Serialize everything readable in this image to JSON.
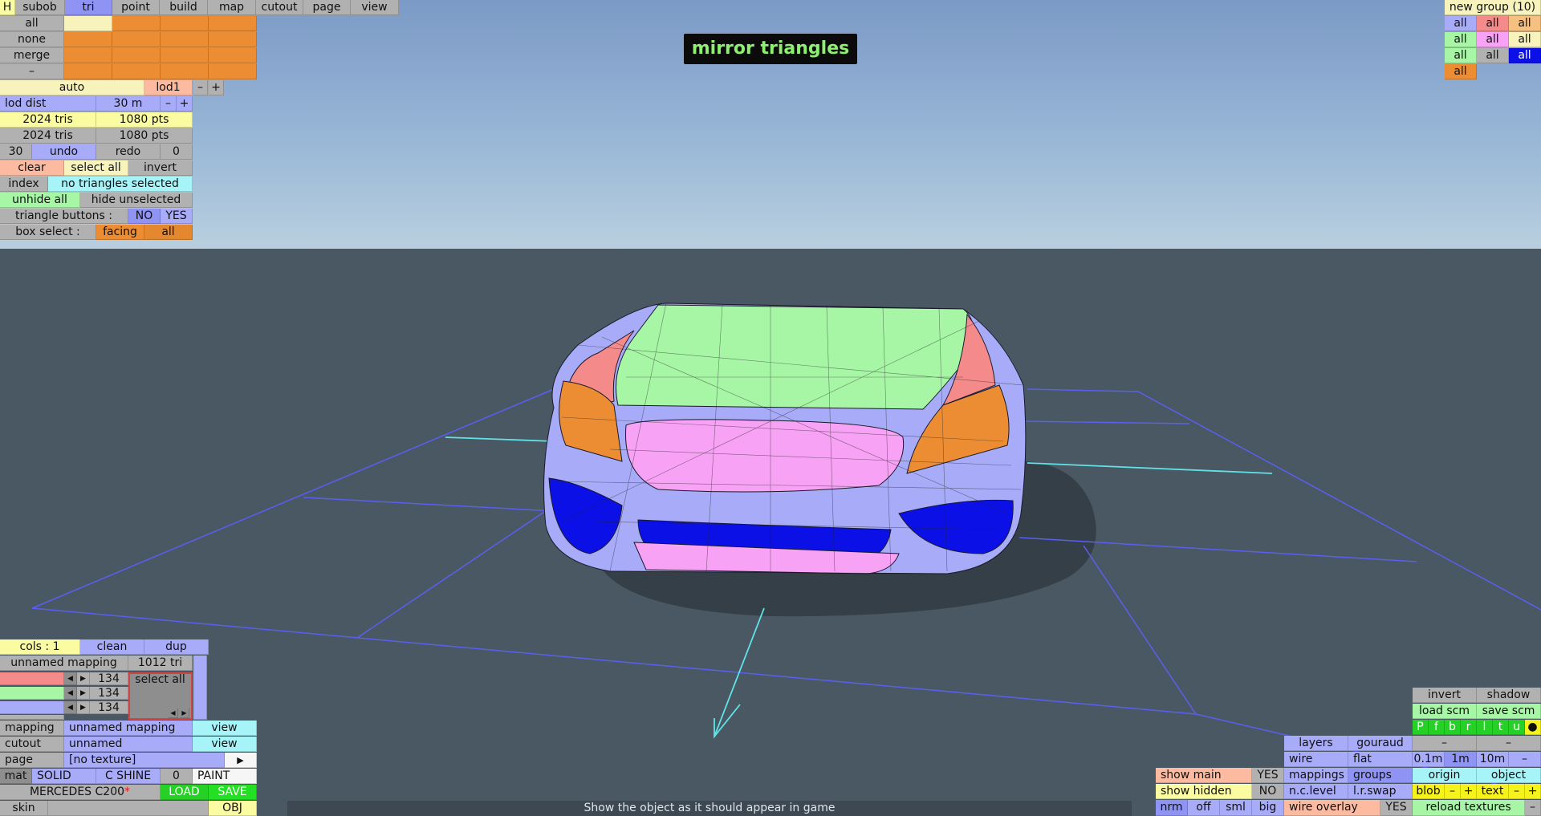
{
  "title": "mirror triangles",
  "menu": {
    "tabs": [
      "H",
      "subob",
      "tri",
      "point",
      "build",
      "map",
      "cutout",
      "page",
      "view"
    ]
  },
  "selection": {
    "rows": [
      "all",
      "none",
      "merge",
      "–"
    ]
  },
  "lod": {
    "auto": "auto",
    "name": "lod1",
    "minus": "–",
    "plus": "+",
    "dist_label": "lod dist",
    "dist_value": "30 m"
  },
  "stats": {
    "tris1": "2024 tris",
    "pts1": "1080 pts",
    "tris2": "2024 tris",
    "pts2": "1080 pts"
  },
  "history": {
    "count": "30",
    "undo": "undo",
    "redo": "redo",
    "redo_count": "0"
  },
  "edit": {
    "clear": "clear",
    "select_all": "select all",
    "invert": "invert"
  },
  "index": {
    "label": "index",
    "value": "no triangles selected"
  },
  "visibility": {
    "unhide_all": "unhide all",
    "hide_unselected": "hide unselected"
  },
  "triangle_buttons": {
    "label": "triangle buttons :",
    "no": "NO",
    "yes": "YES"
  },
  "box_select": {
    "label": "box select :",
    "facing": "facing",
    "all": "all"
  },
  "groups_panel": {
    "title": "new group (10)",
    "all": "all"
  },
  "cols": {
    "label": "cols : 1",
    "clean": "clean",
    "dup": "dup",
    "mapping_name": "unnamed mapping",
    "tri_count": "1012 tri",
    "rows": [
      {
        "count": "134",
        "color": "#f48a8a"
      },
      {
        "count": "134",
        "color": "#a6f6a6"
      },
      {
        "count": "134",
        "color": "#a8abf8"
      }
    ],
    "select_all": "select all"
  },
  "bottom_left": {
    "mapping_label": "mapping",
    "mapping_value": "unnamed mapping",
    "view": "view",
    "cutout_label": "cutout",
    "cutout_value": "unnamed",
    "page_label": "page",
    "page_value": "[no texture]",
    "arrow": "▶",
    "mat": "mat",
    "solid": "SOLID",
    "cshine": "C SHINE",
    "zero": "0",
    "paint": "PAINT",
    "file": "MERCEDES C200",
    "asterisk": "*",
    "load": "LOAD",
    "save": "SAVE",
    "skin": "skin",
    "obj": "OBJ"
  },
  "status_text": "Show the object as it should appear in game",
  "br": {
    "invert": "invert",
    "shadow": "shadow",
    "load_scm": "load scm",
    "save_scm": "save scm",
    "letters": [
      "P",
      "f",
      "b",
      "r",
      "l",
      "t",
      "u",
      "●"
    ],
    "dash": "–",
    "layers": "layers",
    "gouraud": "gouraud",
    "wire": "wire",
    "flat": "flat",
    "s01": "0.1m",
    "s1": "1m",
    "s10": "10m",
    "mappings": "mappings",
    "groups": "groups",
    "origin": "origin",
    "object": "object",
    "nclevel": "n.c.level",
    "lrswap": "l.r.swap",
    "blob": "blob",
    "plus": "+",
    "text": "text",
    "show_main": "show main",
    "yes": "YES",
    "show_hidden": "show hidden",
    "no": "NO",
    "nrm": "nrm",
    "off": "off",
    "sml": "sml",
    "big": "big",
    "wire_overlay": "wire overlay",
    "reload": "reload textures"
  },
  "colors": {
    "accent": "#8df070",
    "orange": "#ec8d33",
    "blue": "#0b10e6",
    "green": "#27d027"
  }
}
